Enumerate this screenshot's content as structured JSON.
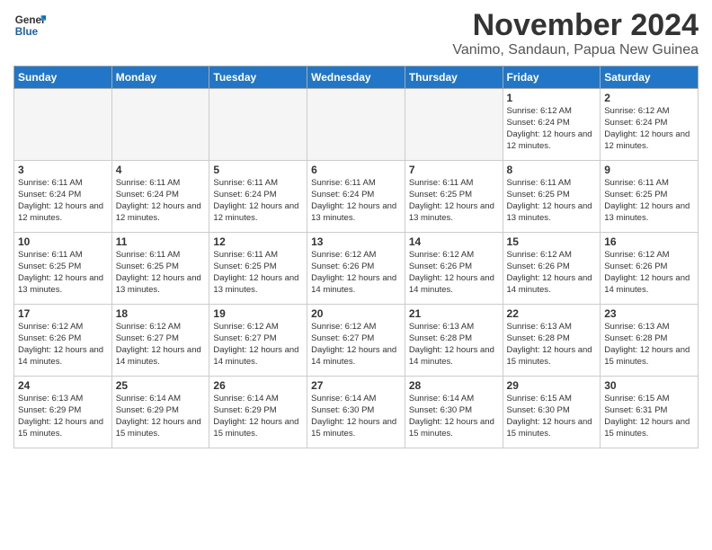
{
  "logo": {
    "general": "General",
    "blue": "Blue"
  },
  "title": "November 2024",
  "location": "Vanimo, Sandaun, Papua New Guinea",
  "days_of_week": [
    "Sunday",
    "Monday",
    "Tuesday",
    "Wednesday",
    "Thursday",
    "Friday",
    "Saturday"
  ],
  "weeks": [
    [
      {
        "day": "",
        "info": ""
      },
      {
        "day": "",
        "info": ""
      },
      {
        "day": "",
        "info": ""
      },
      {
        "day": "",
        "info": ""
      },
      {
        "day": "",
        "info": ""
      },
      {
        "day": "1",
        "info": "Sunrise: 6:12 AM\nSunset: 6:24 PM\nDaylight: 12 hours and 12 minutes."
      },
      {
        "day": "2",
        "info": "Sunrise: 6:12 AM\nSunset: 6:24 PM\nDaylight: 12 hours and 12 minutes."
      }
    ],
    [
      {
        "day": "3",
        "info": "Sunrise: 6:11 AM\nSunset: 6:24 PM\nDaylight: 12 hours and 12 minutes."
      },
      {
        "day": "4",
        "info": "Sunrise: 6:11 AM\nSunset: 6:24 PM\nDaylight: 12 hours and 12 minutes."
      },
      {
        "day": "5",
        "info": "Sunrise: 6:11 AM\nSunset: 6:24 PM\nDaylight: 12 hours and 12 minutes."
      },
      {
        "day": "6",
        "info": "Sunrise: 6:11 AM\nSunset: 6:24 PM\nDaylight: 12 hours and 13 minutes."
      },
      {
        "day": "7",
        "info": "Sunrise: 6:11 AM\nSunset: 6:25 PM\nDaylight: 12 hours and 13 minutes."
      },
      {
        "day": "8",
        "info": "Sunrise: 6:11 AM\nSunset: 6:25 PM\nDaylight: 12 hours and 13 minutes."
      },
      {
        "day": "9",
        "info": "Sunrise: 6:11 AM\nSunset: 6:25 PM\nDaylight: 12 hours and 13 minutes."
      }
    ],
    [
      {
        "day": "10",
        "info": "Sunrise: 6:11 AM\nSunset: 6:25 PM\nDaylight: 12 hours and 13 minutes."
      },
      {
        "day": "11",
        "info": "Sunrise: 6:11 AM\nSunset: 6:25 PM\nDaylight: 12 hours and 13 minutes."
      },
      {
        "day": "12",
        "info": "Sunrise: 6:11 AM\nSunset: 6:25 PM\nDaylight: 12 hours and 13 minutes."
      },
      {
        "day": "13",
        "info": "Sunrise: 6:12 AM\nSunset: 6:26 PM\nDaylight: 12 hours and 14 minutes."
      },
      {
        "day": "14",
        "info": "Sunrise: 6:12 AM\nSunset: 6:26 PM\nDaylight: 12 hours and 14 minutes."
      },
      {
        "day": "15",
        "info": "Sunrise: 6:12 AM\nSunset: 6:26 PM\nDaylight: 12 hours and 14 minutes."
      },
      {
        "day": "16",
        "info": "Sunrise: 6:12 AM\nSunset: 6:26 PM\nDaylight: 12 hours and 14 minutes."
      }
    ],
    [
      {
        "day": "17",
        "info": "Sunrise: 6:12 AM\nSunset: 6:26 PM\nDaylight: 12 hours and 14 minutes."
      },
      {
        "day": "18",
        "info": "Sunrise: 6:12 AM\nSunset: 6:27 PM\nDaylight: 12 hours and 14 minutes."
      },
      {
        "day": "19",
        "info": "Sunrise: 6:12 AM\nSunset: 6:27 PM\nDaylight: 12 hours and 14 minutes."
      },
      {
        "day": "20",
        "info": "Sunrise: 6:12 AM\nSunset: 6:27 PM\nDaylight: 12 hours and 14 minutes."
      },
      {
        "day": "21",
        "info": "Sunrise: 6:13 AM\nSunset: 6:28 PM\nDaylight: 12 hours and 14 minutes."
      },
      {
        "day": "22",
        "info": "Sunrise: 6:13 AM\nSunset: 6:28 PM\nDaylight: 12 hours and 15 minutes."
      },
      {
        "day": "23",
        "info": "Sunrise: 6:13 AM\nSunset: 6:28 PM\nDaylight: 12 hours and 15 minutes."
      }
    ],
    [
      {
        "day": "24",
        "info": "Sunrise: 6:13 AM\nSunset: 6:29 PM\nDaylight: 12 hours and 15 minutes."
      },
      {
        "day": "25",
        "info": "Sunrise: 6:14 AM\nSunset: 6:29 PM\nDaylight: 12 hours and 15 minutes."
      },
      {
        "day": "26",
        "info": "Sunrise: 6:14 AM\nSunset: 6:29 PM\nDaylight: 12 hours and 15 minutes."
      },
      {
        "day": "27",
        "info": "Sunrise: 6:14 AM\nSunset: 6:30 PM\nDaylight: 12 hours and 15 minutes."
      },
      {
        "day": "28",
        "info": "Sunrise: 6:14 AM\nSunset: 6:30 PM\nDaylight: 12 hours and 15 minutes."
      },
      {
        "day": "29",
        "info": "Sunrise: 6:15 AM\nSunset: 6:30 PM\nDaylight: 12 hours and 15 minutes."
      },
      {
        "day": "30",
        "info": "Sunrise: 6:15 AM\nSunset: 6:31 PM\nDaylight: 12 hours and 15 minutes."
      }
    ]
  ]
}
